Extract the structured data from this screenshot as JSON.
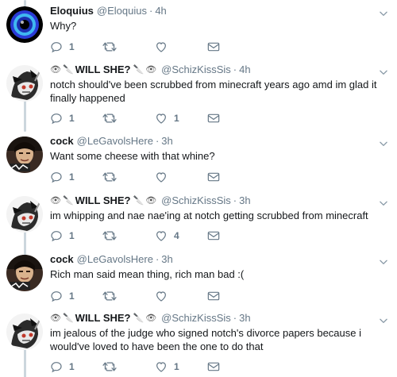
{
  "tweets": [
    {
      "name": "Eloquius",
      "handle": "@Eloquius",
      "time": "4h",
      "text": "Why?",
      "reply_count": "1",
      "retweet_count": "",
      "like_count": "",
      "avatar": "eloquius"
    },
    {
      "name": "WILL SHE?",
      "handle": "@SchizKissSis",
      "time": "4h",
      "text": "notch should've been scrubbed from minecraft years ago amd im glad it finally happened",
      "reply_count": "1",
      "retweet_count": "",
      "like_count": "1",
      "avatar": "willshe"
    },
    {
      "name": "cock",
      "handle": "@LeGavolsHere",
      "time": "3h",
      "text": "Want some cheese with that whine?",
      "reply_count": "1",
      "retweet_count": "",
      "like_count": "",
      "avatar": "cock"
    },
    {
      "name": "WILL SHE?",
      "handle": "@SchizKissSis",
      "time": "3h",
      "text": "im whipping and nae nae'ing at notch getting scrubbed from minecraft",
      "reply_count": "1",
      "retweet_count": "",
      "like_count": "4",
      "avatar": "willshe"
    },
    {
      "name": "cock",
      "handle": "@LeGavolsHere",
      "time": "3h",
      "text": "Rich man said mean thing, rich man bad :(",
      "reply_count": "1",
      "retweet_count": "",
      "like_count": "",
      "avatar": "cock"
    },
    {
      "name": "WILL SHE?",
      "handle": "@SchizKissSis",
      "time": "3h",
      "text": "im jealous of the judge who signed notch's divorce papers because i would've loved to have been the one to do that",
      "reply_count": "1",
      "retweet_count": "",
      "like_count": "1",
      "avatar": "willshe"
    }
  ],
  "separator": "·",
  "icons": {
    "reply": "reply-icon",
    "retweet": "retweet-icon",
    "like": "heart-icon",
    "dm": "envelope-icon",
    "caret": "chevron-down-icon"
  },
  "colors": {
    "text": "#14171a",
    "muted": "#657786",
    "thread_line": "#ccd6dd"
  }
}
